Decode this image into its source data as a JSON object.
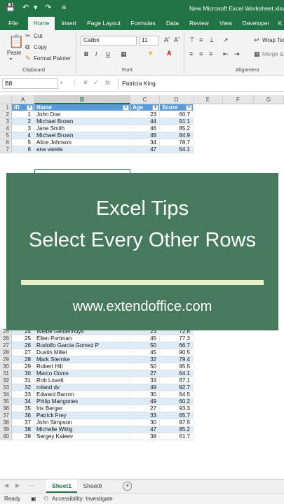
{
  "titlebar": {
    "save_icon": "save-icon",
    "undo_icon": "undo-icon",
    "redo_icon": "redo-icon",
    "doc_title": "New Microsoft Excel Worksheet.xlsx"
  },
  "tabs": [
    "File",
    "Home",
    "Insert",
    "Page Layout",
    "Formulas",
    "Data",
    "Review",
    "View",
    "Developer",
    "K"
  ],
  "ribbon": {
    "paste_label": "Paste",
    "cut_label": "Cut",
    "copy_label": "Copy",
    "format_painter_label": "Format Painter",
    "clipboard_group": "Clipboard",
    "font_name": "Calibri",
    "font_size": "11",
    "font_group": "Font",
    "bold": "B",
    "italic": "I",
    "underline": "U",
    "wrap_text": "Wrap Tex",
    "merge": "Merge &",
    "alignment_group": "Alignment"
  },
  "formula_bar": {
    "name_box": "B8",
    "fx": "fx",
    "value": "Patricia King"
  },
  "columns": [
    "A",
    "B",
    "C",
    "D",
    "E",
    "F",
    "G"
  ],
  "table_headers": [
    "ID",
    "Name",
    "Age",
    "Score"
  ],
  "rows_top": [
    {
      "r": "2",
      "id": "1",
      "name": "John Doe",
      "age": "23",
      "score": "60.7"
    },
    {
      "r": "3",
      "id": "2",
      "name": "Michael Brown",
      "age": "44",
      "score": "91.1"
    },
    {
      "r": "4",
      "id": "3",
      "name": "Jane Smith",
      "age": "46",
      "score": "85.2"
    },
    {
      "r": "5",
      "id": "4",
      "name": "Michael Brown",
      "age": "48",
      "score": "84.9"
    },
    {
      "r": "6",
      "id": "5",
      "name": "Alice Johnson",
      "age": "34",
      "score": "78.7"
    },
    {
      "r": "7",
      "id": "6",
      "name": "ana varela",
      "age": "47",
      "score": "64.1"
    }
  ],
  "rows_bottom": [
    {
      "r": "25",
      "id": "24",
      "name": "Wiebe Geldenhuys",
      "age": "23",
      "score": "72.6"
    },
    {
      "r": "26",
      "id": "25",
      "name": "Ellen Portman",
      "age": "45",
      "score": "77.3"
    },
    {
      "r": "27",
      "id": "26",
      "name": "Rodolfo Garcia Gomez P",
      "age": "50",
      "score": "66.7"
    },
    {
      "r": "28",
      "id": "27",
      "name": "Dustin Miller",
      "age": "45",
      "score": "90.5"
    },
    {
      "r": "29",
      "id": "28",
      "name": "Mark Sternke",
      "age": "32",
      "score": "79.4"
    },
    {
      "r": "30",
      "id": "29",
      "name": "Robert Hill",
      "age": "50",
      "score": "95.5"
    },
    {
      "r": "31",
      "id": "30",
      "name": "Marco Ooms",
      "age": "27",
      "score": "64.1"
    },
    {
      "r": "32",
      "id": "31",
      "name": "Rob Lovett",
      "age": "33",
      "score": "87.1"
    },
    {
      "r": "33",
      "id": "32",
      "name": "roland dv",
      "age": "49",
      "score": "92.7"
    },
    {
      "r": "34",
      "id": "33",
      "name": "Edward Barron",
      "age": "30",
      "score": "64.5"
    },
    {
      "r": "35",
      "id": "34",
      "name": "Philip Mangones",
      "age": "49",
      "score": "60.2"
    },
    {
      "r": "36",
      "id": "35",
      "name": "Iris Berger",
      "age": "27",
      "score": "93.3"
    },
    {
      "r": "37",
      "id": "36",
      "name": "Patrick Frey",
      "age": "33",
      "score": "65.7"
    },
    {
      "r": "38",
      "id": "37",
      "name": "John Simpson",
      "age": "30",
      "score": "97.5"
    },
    {
      "r": "39",
      "id": "38",
      "name": "Michelle Wittig",
      "age": "47",
      "score": "85.2"
    },
    {
      "r": "40",
      "id": "39",
      "name": "Sergey Kaleev",
      "age": "38",
      "score": "61.7"
    }
  ],
  "overlay": {
    "line1": "Excel Tips",
    "line2": "Select Every Other Rows",
    "url": "www.extendoffice.com"
  },
  "sheets": [
    "Sheet1",
    "Sheet6"
  ],
  "status": {
    "ready": "Ready",
    "accessibility": "Accessibility: Investigate"
  }
}
